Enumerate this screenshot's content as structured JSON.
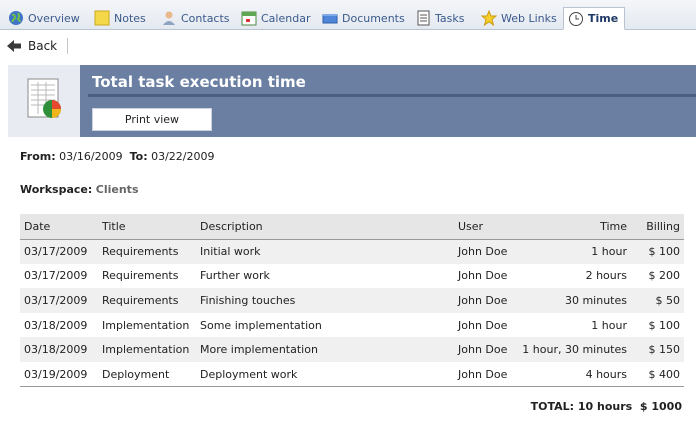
{
  "tabs": [
    {
      "label": "Overview",
      "icon": "globe-icon"
    },
    {
      "label": "Notes",
      "icon": "note-icon"
    },
    {
      "label": "Contacts",
      "icon": "contact-icon"
    },
    {
      "label": "Calendar",
      "icon": "calendar-icon"
    },
    {
      "label": "Documents",
      "icon": "documents-icon"
    },
    {
      "label": "Tasks",
      "icon": "tasks-icon"
    },
    {
      "label": "Web Links",
      "icon": "star-icon"
    },
    {
      "label": "Time",
      "icon": "clock-icon",
      "active": true
    }
  ],
  "back": {
    "label": "Back"
  },
  "header": {
    "title": "Total task execution time",
    "print_label": "Print view"
  },
  "filter": {
    "from_label": "From",
    "from_value": "03/16/2009",
    "to_label": "To",
    "to_value": "03/22/2009",
    "workspace_label": "Workspace",
    "workspace_value": "Clients"
  },
  "table": {
    "headers": [
      "Date",
      "Title",
      "Description",
      "User",
      "Time",
      "Billing"
    ],
    "rows": [
      [
        "03/17/2009",
        "Requirements",
        "Initial work",
        "John Doe",
        "1 hour",
        "$ 100"
      ],
      [
        "03/17/2009",
        "Requirements",
        "Further work",
        "John Doe",
        "2 hours",
        "$ 200"
      ],
      [
        "03/17/2009",
        "Requirements",
        "Finishing touches",
        "John Doe",
        "30 minutes",
        "$ 50"
      ],
      [
        "03/18/2009",
        "Implementation",
        "Some implementation",
        "John Doe",
        "1 hour",
        "$ 100"
      ],
      [
        "03/18/2009",
        "Implementation",
        "More implementation",
        "John Doe",
        "1 hour, 30 minutes",
        "$ 150"
      ],
      [
        "03/19/2009",
        "Deployment",
        "Deployment work",
        "John Doe",
        "4 hours",
        "$ 400"
      ]
    ]
  },
  "total": {
    "label": "TOTAL:",
    "time": "10 hours",
    "billing": "$ 1000"
  }
}
